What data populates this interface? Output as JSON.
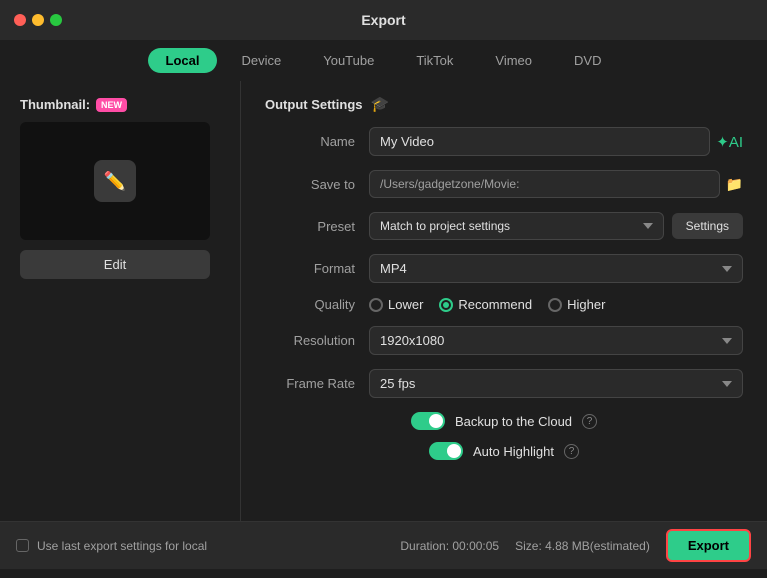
{
  "titleBar": {
    "title": "Export"
  },
  "tabs": [
    {
      "id": "local",
      "label": "Local",
      "active": true
    },
    {
      "id": "device",
      "label": "Device",
      "active": false
    },
    {
      "id": "youtube",
      "label": "YouTube",
      "active": false
    },
    {
      "id": "tiktok",
      "label": "TikTok",
      "active": false
    },
    {
      "id": "vimeo",
      "label": "Vimeo",
      "active": false
    },
    {
      "id": "dvd",
      "label": "DVD",
      "active": false
    }
  ],
  "leftPanel": {
    "thumbnailLabel": "Thumbnail:",
    "newBadge": "NEW",
    "editButtonLabel": "Edit"
  },
  "rightPanel": {
    "outputSettingsLabel": "Output Settings",
    "fields": {
      "nameLabel": "Name",
      "nameValue": "My Video",
      "saveToLabel": "Save to",
      "saveToValue": "/Users/gadgetzone/Movie:",
      "presetLabel": "Preset",
      "presetValue": "Match to project settings",
      "settingsButtonLabel": "Settings",
      "formatLabel": "Format",
      "formatValue": "MP4",
      "qualityLabel": "Quality",
      "qualityOptions": [
        "Lower",
        "Recommend",
        "Higher"
      ],
      "qualitySelected": "Recommend",
      "resolutionLabel": "Resolution",
      "resolutionValue": "1920x1080",
      "frameRateLabel": "Frame Rate",
      "frameRateValue": "25 fps",
      "backupLabel": "Backup to the Cloud",
      "backupEnabled": true,
      "autoHighlightLabel": "Auto Highlight",
      "autoHighlightEnabled": true
    }
  },
  "bottomBar": {
    "useLastLabel": "Use last export settings for local",
    "durationLabel": "Duration: 00:00:05",
    "sizeLabel": "Size: 4.88 MB(estimated)",
    "exportButtonLabel": "Export"
  }
}
